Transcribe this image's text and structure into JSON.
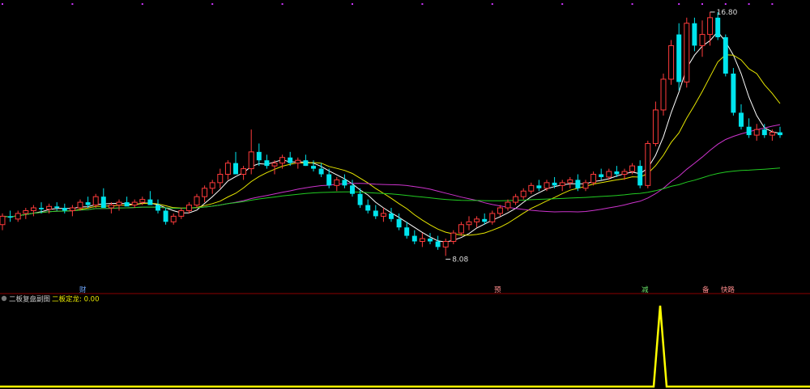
{
  "colors": {
    "up": "#ff3b3b",
    "down": "#00e5ee",
    "ma_fast": "#ffffff",
    "ma_mid": "#e6e600",
    "ma_slow": "#cc33cc",
    "ma_long": "#22cc22",
    "divider": "#8b0000",
    "indicator": "#ffff00",
    "marker_dot": "#cc33ff"
  },
  "price_annotations": {
    "high_label": "16.80",
    "low_label": "8.08"
  },
  "event_tags": [
    {
      "text": "财",
      "color": "#6fa8ff"
    },
    {
      "text": "预",
      "color": "#ff8c8c"
    },
    {
      "text": "减",
      "color": "#66dd66"
    },
    {
      "text": "备",
      "color": "#ff8c8c"
    },
    {
      "text": "快路",
      "color": "#ff8c8c"
    }
  ],
  "indicator_panel": {
    "name": "二板复盘副图",
    "series_label": "二板定龙: 0.00",
    "icon": "circle-icon"
  },
  "chart_data": [
    {
      "type": "candlestick",
      "title": "",
      "price_range": [
        7.4,
        17.0
      ],
      "annotated_high": 16.8,
      "annotated_low": 8.08,
      "candles": [
        [
          9.2,
          9.6,
          9.0,
          9.5
        ],
        [
          9.5,
          9.7,
          9.3,
          9.45
        ],
        [
          9.4,
          9.7,
          9.3,
          9.6
        ],
        [
          9.6,
          9.8,
          9.4,
          9.7
        ],
        [
          9.7,
          9.9,
          9.5,
          9.8
        ],
        [
          9.8,
          10.0,
          9.6,
          9.75
        ],
        [
          9.75,
          9.95,
          9.6,
          9.85
        ],
        [
          9.85,
          10.0,
          9.7,
          9.8
        ],
        [
          9.8,
          9.95,
          9.6,
          9.7
        ],
        [
          9.7,
          9.9,
          9.5,
          9.8
        ],
        [
          9.8,
          10.1,
          9.7,
          10.0
        ],
        [
          10.0,
          10.2,
          9.8,
          9.9
        ],
        [
          9.9,
          10.3,
          9.8,
          10.2
        ],
        [
          10.2,
          10.5,
          10.0,
          9.8
        ],
        [
          9.8,
          10.0,
          9.6,
          9.9
        ],
        [
          9.9,
          10.1,
          9.7,
          10.0
        ],
        [
          10.0,
          10.2,
          9.9,
          9.85
        ],
        [
          9.9,
          10.1,
          9.8,
          10.0
        ],
        [
          10.0,
          10.2,
          9.9,
          10.1
        ],
        [
          10.1,
          10.4,
          10.0,
          9.9
        ],
        [
          9.9,
          10.1,
          9.6,
          9.7
        ],
        [
          9.7,
          9.8,
          9.2,
          9.3
        ],
        [
          9.3,
          9.6,
          9.2,
          9.5
        ],
        [
          9.5,
          9.8,
          9.4,
          9.7
        ],
        [
          9.7,
          10.0,
          9.6,
          9.9
        ],
        [
          9.9,
          10.3,
          9.8,
          10.2
        ],
        [
          10.2,
          10.6,
          10.0,
          10.5
        ],
        [
          10.5,
          10.8,
          10.3,
          10.7
        ],
        [
          10.7,
          11.2,
          10.5,
          11.0
        ],
        [
          11.0,
          11.5,
          10.8,
          11.4
        ],
        [
          11.4,
          11.8,
          11.2,
          11.0
        ],
        [
          11.0,
          11.3,
          10.8,
          11.2
        ],
        [
          11.2,
          12.6,
          11.0,
          11.8
        ],
        [
          11.8,
          12.1,
          11.3,
          11.5
        ],
        [
          11.5,
          11.7,
          11.2,
          11.3
        ],
        [
          11.3,
          11.5,
          11.0,
          11.4
        ],
        [
          11.4,
          11.7,
          11.2,
          11.6
        ],
        [
          11.6,
          11.8,
          11.3,
          11.4
        ],
        [
          11.4,
          11.6,
          11.2,
          11.5
        ],
        [
          11.5,
          11.7,
          11.3,
          11.3
        ],
        [
          11.3,
          11.5,
          11.1,
          11.2
        ],
        [
          11.2,
          11.4,
          10.9,
          11.0
        ],
        [
          11.0,
          11.2,
          10.5,
          10.6
        ],
        [
          10.6,
          10.9,
          10.4,
          10.8
        ],
        [
          10.8,
          11.0,
          10.5,
          10.6
        ],
        [
          10.6,
          10.8,
          10.2,
          10.3
        ],
        [
          10.3,
          10.5,
          9.8,
          9.9
        ],
        [
          9.9,
          10.1,
          9.6,
          9.7
        ],
        [
          9.7,
          9.9,
          9.4,
          9.5
        ],
        [
          9.5,
          9.8,
          9.3,
          9.6
        ],
        [
          9.6,
          9.8,
          9.3,
          9.4
        ],
        [
          9.4,
          9.6,
          9.0,
          9.1
        ],
        [
          9.1,
          9.3,
          8.7,
          8.8
        ],
        [
          8.8,
          9.0,
          8.5,
          8.6
        ],
        [
          8.6,
          8.9,
          8.4,
          8.7
        ],
        [
          8.7,
          8.9,
          8.5,
          8.6
        ],
        [
          8.6,
          8.8,
          8.3,
          8.4
        ],
        [
          8.4,
          8.7,
          8.08,
          8.6
        ],
        [
          8.6,
          9.0,
          8.5,
          8.9
        ],
        [
          8.9,
          9.3,
          8.8,
          9.2
        ],
        [
          9.2,
          9.5,
          9.0,
          9.3
        ],
        [
          9.3,
          9.5,
          9.1,
          9.4
        ],
        [
          9.4,
          9.6,
          9.2,
          9.3
        ],
        [
          9.3,
          9.7,
          9.2,
          9.6
        ],
        [
          9.6,
          9.9,
          9.5,
          9.8
        ],
        [
          9.8,
          10.1,
          9.7,
          10.0
        ],
        [
          10.0,
          10.3,
          9.9,
          10.2
        ],
        [
          10.2,
          10.5,
          10.1,
          10.4
        ],
        [
          10.4,
          10.7,
          10.3,
          10.6
        ],
        [
          10.6,
          10.8,
          10.4,
          10.5
        ],
        [
          10.5,
          10.8,
          10.4,
          10.7
        ],
        [
          10.7,
          10.9,
          10.5,
          10.6
        ],
        [
          10.6,
          10.8,
          10.4,
          10.7
        ],
        [
          10.7,
          10.9,
          10.5,
          10.8
        ],
        [
          10.8,
          11.0,
          10.4,
          10.5
        ],
        [
          10.5,
          10.8,
          10.4,
          10.7
        ],
        [
          10.7,
          11.1,
          10.6,
          11.0
        ],
        [
          11.0,
          11.2,
          10.8,
          10.9
        ],
        [
          10.9,
          11.2,
          10.8,
          11.1
        ],
        [
          11.1,
          11.3,
          10.9,
          11.0
        ],
        [
          11.0,
          11.2,
          10.8,
          11.1
        ],
        [
          11.1,
          11.4,
          11.0,
          11.3
        ],
        [
          11.3,
          11.5,
          10.5,
          10.6
        ],
        [
          10.6,
          12.2,
          10.5,
          12.1
        ],
        [
          12.1,
          13.6,
          12.0,
          13.3
        ],
        [
          13.3,
          14.6,
          13.1,
          14.4
        ],
        [
          14.4,
          15.8,
          14.2,
          15.6
        ],
        [
          16.0,
          16.4,
          14.0,
          14.3
        ],
        [
          14.3,
          16.6,
          14.1,
          16.4
        ],
        [
          16.4,
          16.6,
          15.4,
          15.6
        ],
        [
          15.6,
          16.5,
          15.2,
          16.0
        ],
        [
          16.0,
          16.8,
          15.6,
          16.6
        ],
        [
          16.6,
          16.8,
          15.8,
          15.9
        ],
        [
          15.9,
          16.0,
          14.5,
          14.6
        ],
        [
          14.6,
          14.8,
          13.1,
          13.2
        ],
        [
          13.2,
          13.5,
          12.6,
          12.7
        ],
        [
          12.7,
          13.0,
          12.3,
          12.4
        ],
        [
          12.4,
          12.8,
          12.2,
          12.6
        ],
        [
          12.6,
          12.8,
          12.3,
          12.4
        ],
        [
          12.4,
          12.6,
          12.2,
          12.5
        ],
        [
          12.5,
          12.7,
          12.3,
          12.4
        ]
      ],
      "moving_averages": [
        {
          "period": 5,
          "color_key": "ma_fast"
        },
        {
          "period": 10,
          "color_key": "ma_mid"
        },
        {
          "period": 30,
          "color_key": "ma_slow"
        },
        {
          "period": 60,
          "color_key": "ma_long"
        }
      ]
    },
    {
      "type": "line",
      "series": [
        {
          "name": "二板定龙",
          "values_note_index": 85,
          "spike_value": 1
        }
      ],
      "current_value": 0.0
    }
  ]
}
